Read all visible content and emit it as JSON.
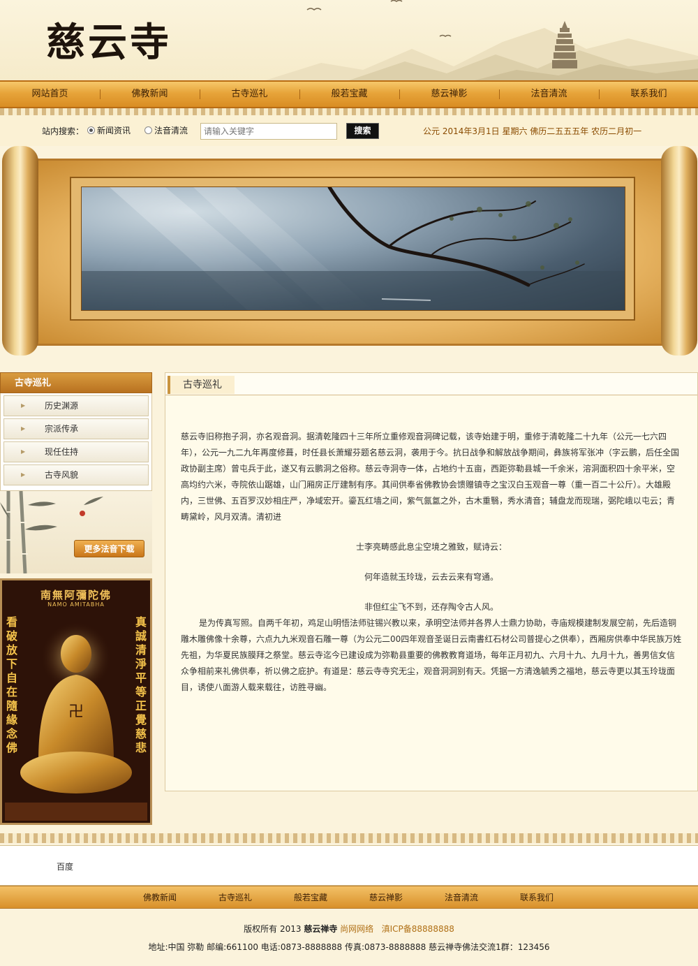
{
  "site": {
    "logo": "慈云寺"
  },
  "nav": [
    "网站首页",
    "佛教新闻",
    "古寺巡礼",
    "般若宝藏",
    "慈云禅影",
    "法音清流",
    "联系我们"
  ],
  "search": {
    "label": "站内搜索：",
    "option1": "新闻资讯",
    "option2": "法音清流",
    "option1_selected": true,
    "placeholder": "请输入关键字",
    "button": "搜索",
    "date": "公元 2014年3月1日 星期六 佛历二五五五年 农历二月初一"
  },
  "sidebar": {
    "title": "古寺巡礼",
    "items": [
      "历史渊源",
      "宗派传承",
      "现任住持",
      "古寺风貌"
    ],
    "download_button": "更多法音下载",
    "buddha_title": "南無阿彌陀佛",
    "buddha_sub": "NAMO AMITABHA",
    "buddha_left": "看破放下自在隨緣念佛",
    "buddha_right": "真誠清淨平等正覺慈悲"
  },
  "main": {
    "title": "古寺巡礼",
    "p1": "慈云寺旧称抱子洞，亦名观音洞。据清乾隆四十三年所立重修观音洞碑记载，该寺始建于明，重修于清乾隆二十九年（公元一七六四年），公元一九二九年再度修葺，时任县长萧耀芬题名慈云洞，袭用于今。抗日战争和解放战争期间，彝族将军张冲（字云鹏，后任全国政协副主席）曾屯兵于此，遂又有云鹏洞之俗称。慈云寺洞寺一体，占地约十五亩，西距弥勒县城一千余米，溶洞面积四十余平米，空高均约六米，寺院依山踞雄，山门厢房正厅建制有序。其间供奉省佛教协会馈赠镇寺之宝汉白玉观音一尊（重一百二十公斤）。大雄殿内，三世佛、五百罗汉妙相庄严，净域宏开。鎏瓦红墙之间，紫气氤氲之外，古木重翳，秀水清音；辅盘龙而现瑞，弼陀峨以屯云；青畴黛岭，风月双清。清初进",
    "c1": "士李亮畴感此息尘空境之雅致，赋诗云：",
    "c2": "何年造就玉玲珑，云去云来有穹通。",
    "c3": "非但红尘飞不到，还存陶令古人风。",
    "p2": "是为传真写照。自两千年初，鸡足山明悟法师驻锡兴教以来，承明空法师并各界人士鼎力协助，寺庙规模建制发展空前，先后造铜雕木雕佛像十余尊，六点九九米观音石雕一尊（为公元二00四年观音圣诞日云南書红石材公司普提心之供奉），西厢房供奉中华民族万姓先祖，为华夏民族膜拜之祭堂。慈云寺迄今已建设成为弥勒县重要的佛教教育道场，每年正月初九、六月十九、九月十九，善男信女信众争相前来礼佛供奉，祈以佛之庇护。有道是：慈云寺寺究无尘，观音洞洞别有天。凭据一方清逸毓秀之福地，慈云寺更以其玉玲珑面目，诱使八面游人载来载往，访胜寻幽。"
  },
  "links": {
    "label": "百度"
  },
  "footer_nav": [
    "佛教新闻",
    "古寺巡礼",
    "般若宝藏",
    "慈云禅影",
    "法音清流",
    "联系我们"
  ],
  "footer": {
    "copy_prefix": "版权所有 2013",
    "copy_name": "慈云禅寺",
    "copy_company": "尚网网络",
    "icp": "滇ICP备88888888",
    "address": "地址:中国 弥勒 邮编:661100 电话:0873-8888888 传真:0873-8888888 慈云禅寺佛法交流1群：123456"
  },
  "colors": {
    "nav_bar": "#e7a43a",
    "page_bg": "#fbf3dc",
    "date_text": "#8a4b00",
    "accent": "#b07016"
  }
}
